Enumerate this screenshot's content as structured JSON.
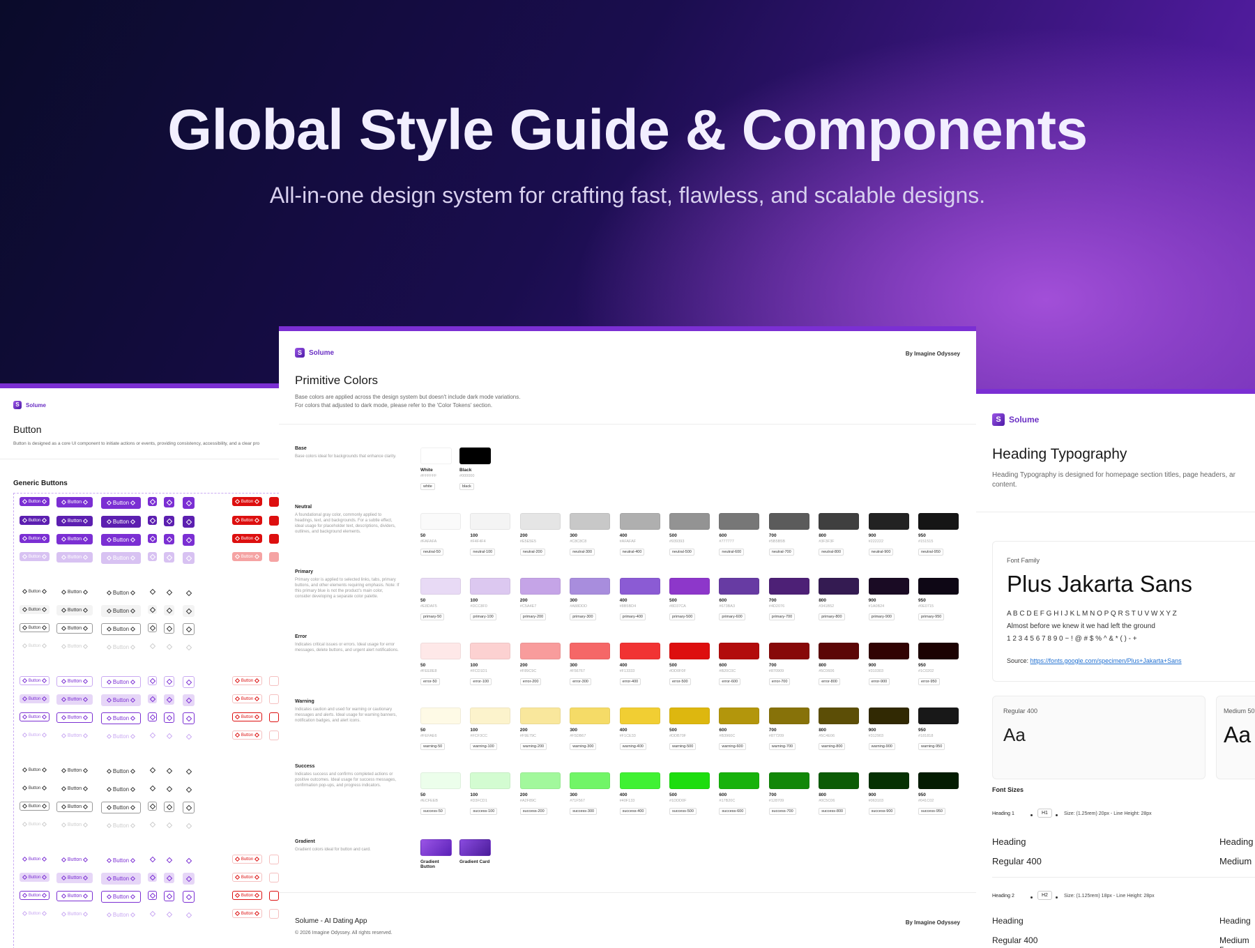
{
  "hero": {
    "title": "Global Style Guide & Components",
    "subtitle": "All-in-one design system for crafting fast, flawless, and scalable designs."
  },
  "brand": {
    "name": "Solume",
    "by": "By Imagine Odyssey",
    "accent": "#7B2FD3"
  },
  "button_panel": {
    "title": "Button",
    "description": "Button is designed as a core UI component to initiate actions or events, providing consistency, accessibility, and a clear pro",
    "section": "Generic Buttons",
    "button_label": "Button"
  },
  "colors_panel": {
    "title": "Primitive Colors",
    "description_1": "Base colors are applied across the design system but doesn't include dark mode variations.",
    "description_2": "For colors that adjusted to dark mode, please refer to the 'Color Tokens' section.",
    "base": {
      "title": "Base",
      "description": "Base colors ideal for backgrounds that enhance clarity.",
      "swatches": [
        {
          "name": "White",
          "hex": "#FFFFFF",
          "token": "white",
          "color": "#FFFFFF"
        },
        {
          "name": "Black",
          "hex": "#000000",
          "token": "black",
          "color": "#000000"
        }
      ]
    },
    "scale_steps": [
      "50",
      "100",
      "200",
      "300",
      "400",
      "500",
      "600",
      "700",
      "800",
      "900",
      "950"
    ],
    "groups": [
      {
        "title": "Neutral",
        "prefix": "neutral",
        "description": "A foundational gray color, commonly applied to headings, text, and backgrounds. For a subtle effect, ideal usage for placeholder text, descriptions, dividers, outlines, and background elements.",
        "hex": [
          "#FAFAFA",
          "#F4F4F4",
          "#E5E5E5",
          "#C8C8C8",
          "#AFAFAF",
          "#939393",
          "#777777",
          "#5B5B5B",
          "#3F3F3F",
          "#222222",
          "#151515"
        ]
      },
      {
        "title": "Primary",
        "prefix": "primary",
        "description": "Primary color is applied to selected links, tabs, primary buttons, and other elements requiring emphasis. Note: If this primary blue is not the product's main color, consider developing a separate color palette.",
        "hex": [
          "#E8DAF5",
          "#DCC8F0",
          "#C5A4E7",
          "#A88DDD",
          "#8B5BD4",
          "#8D37CA",
          "#673BA3",
          "#4D2076",
          "#341B52",
          "#1A0B24",
          "#0E0715"
        ]
      },
      {
        "title": "Error",
        "prefix": "error",
        "description": "Indicates critical issues or errors. Ideal usage for error messages, delete buttons, and urgent alert notifications.",
        "hex": [
          "#FEE8E8",
          "#FCD1D1",
          "#F89C9C",
          "#F56767",
          "#F13333",
          "#DD0F0F",
          "#B20C0C",
          "#870909",
          "#5C0606",
          "#310303",
          "#1C0202"
        ]
      },
      {
        "title": "Warning",
        "prefix": "warning",
        "description": "Indicates caution and used for warning or cautionary messages and alerts. Ideal usage for warning banners, notification badges, and alert icons.",
        "hex": [
          "#FEFAE6",
          "#FCF3CC",
          "#F9E79C",
          "#F5DB67",
          "#F1CE33",
          "#DDB70F",
          "#B3960C",
          "#877209",
          "#5C4E06",
          "#312903",
          "#181818"
        ]
      },
      {
        "title": "Success",
        "prefix": "success",
        "description": "Indicates success and confirms completed actions or positive outcomes. Ideal usage for success messages, confirmation pop-ups, and progress indicators.",
        "hex": [
          "#ECFEEB",
          "#D3FCD1",
          "#A2F89C",
          "#71F567",
          "#40F133",
          "#1DDD0F",
          "#17B20C",
          "#128709",
          "#0C5C06",
          "#063103",
          "#041C02"
        ]
      }
    ],
    "gradient": {
      "title": "Gradient",
      "description": "Gradient colors ideal for button and card.",
      "swatches": [
        {
          "name": "Gradient Button",
          "from": "#9B55E6",
          "to": "#5B22B8"
        },
        {
          "name": "Gradient Card",
          "from": "#8A4BDF",
          "to": "#4A1C9A"
        }
      ]
    },
    "footer_title": "Solume - AI Dating App",
    "footer_copy": "© 2026 Imagine Odyssey. All rights reserved."
  },
  "typography_panel": {
    "title": "Heading Typography",
    "description": "Heading Typography is designed for homepage section titles, page headers, ar content.",
    "font_family_label": "Font Family",
    "font_family": "Plus Jakarta Sans",
    "alphabet": "A B C D E F G H I J K L M N O P Q R S T U V W X Y Z",
    "pangram": "Almost before we knew it we had left the ground",
    "digits": "1 2 3 4 5 6 7 8 9 0 ~ ! @ # $ % ^ & * ( ) - +",
    "source_label": "Source:",
    "source_link": "https://fonts.google.com/specimen/Plus+Jakarta+Sans",
    "weights": [
      {
        "label": "Regular 400",
        "sample": "Aa"
      },
      {
        "label": "Medium 50",
        "sample": "Aa"
      }
    ],
    "font_sizes_label": "Font Sizes",
    "headings": [
      {
        "name": "Heading 1",
        "tag": "H1",
        "spec": "Size: (1.25rem) 20px - Line Height: 28px",
        "sample": "Heading",
        "weight_a": "Regular 400",
        "weight_b": "Medium"
      },
      {
        "name": "Heading 2",
        "tag": "H2",
        "spec": "Size: (1.125rem) 18px - Line Height: 28px",
        "sample": "Heading",
        "weight_a": "Regular 400",
        "weight_b": "Medium 5"
      }
    ]
  }
}
